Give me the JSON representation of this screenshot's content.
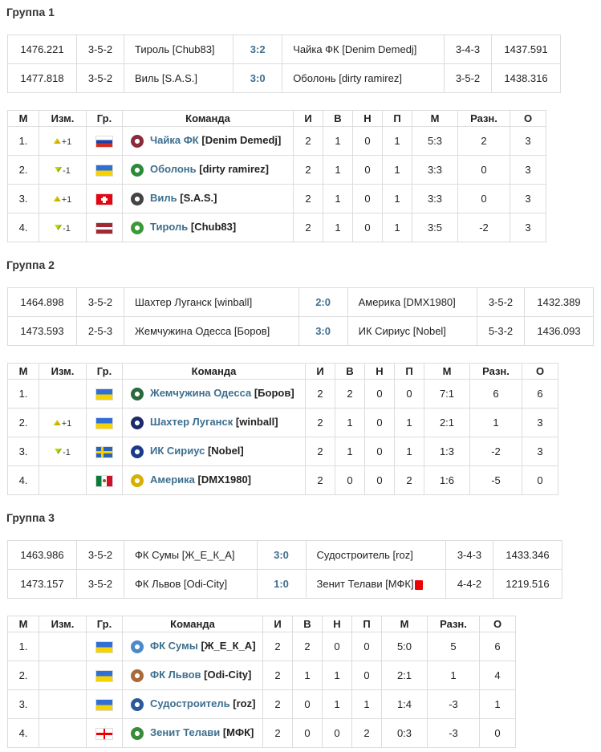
{
  "groups": [
    {
      "title": "Группа 1",
      "matches": [
        {
          "home_rating": "1476.221",
          "home_form": "3-5-2",
          "home": "Тироль [Chub83]",
          "score": "3:2",
          "away": "Чайка ФК [Denim Demedj]",
          "away_form": "3-4-3",
          "away_rating": "1437.591",
          "away_red": false
        },
        {
          "home_rating": "1477.818",
          "home_form": "3-5-2",
          "home": "Виль [S.A.S.]",
          "score": "3:0",
          "away": "Оболонь [dirty ramirez]",
          "away_form": "3-5-2",
          "away_rating": "1438.316",
          "away_red": false
        }
      ],
      "rows": [
        {
          "pos": "1.",
          "chg": "+1",
          "dir": "up",
          "flag": "russia",
          "logo": "seagull-crest-icon",
          "logo_color": "#8a2a3a",
          "team": "Чайка ФК",
          "mgr": "[Denim Demedj]",
          "g": "2",
          "w": "1",
          "d": "0",
          "l": "1",
          "goals": "5:3",
          "diff": "2",
          "pts": "3"
        },
        {
          "pos": "2.",
          "chg": "-1",
          "dir": "down",
          "flag": "ukraine",
          "logo": "obolon-crest-icon",
          "logo_color": "#2a8a3a",
          "team": "Оболонь",
          "mgr": "[dirty ramirez]",
          "g": "2",
          "w": "1",
          "d": "0",
          "l": "1",
          "goals": "3:3",
          "diff": "0",
          "pts": "3"
        },
        {
          "pos": "3.",
          "chg": "+1",
          "dir": "up",
          "flag": "switzerland",
          "logo": "wil-crest-icon",
          "logo_color": "#444444",
          "team": "Виль",
          "mgr": "[S.A.S.]",
          "g": "2",
          "w": "1",
          "d": "0",
          "l": "1",
          "goals": "3:3",
          "diff": "0",
          "pts": "3"
        },
        {
          "pos": "4.",
          "chg": "-1",
          "dir": "down",
          "flag": "latvia",
          "logo": "tyrol-crest-icon",
          "logo_color": "#3a9a3a",
          "team": "Тироль",
          "mgr": "[Chub83]",
          "g": "2",
          "w": "1",
          "d": "0",
          "l": "1",
          "goals": "3:5",
          "diff": "-2",
          "pts": "3"
        }
      ]
    },
    {
      "title": "Группа 2",
      "matches": [
        {
          "home_rating": "1464.898",
          "home_form": "3-5-2",
          "home": "Шахтер Луганск [winball]",
          "score": "2:0",
          "away": "Америка [DMX1980]",
          "away_form": "3-5-2",
          "away_rating": "1432.389",
          "away_red": false
        },
        {
          "home_rating": "1473.593",
          "home_form": "2-5-3",
          "home": "Жемчужина Одесса [Боров]",
          "score": "3:0",
          "away": "ИК Сириус [Nobel]",
          "away_form": "5-3-2",
          "away_rating": "1436.093",
          "away_red": false
        }
      ],
      "rows": [
        {
          "pos": "1.",
          "chg": "",
          "dir": "",
          "flag": "ukraine",
          "logo": "pearl-crest-icon",
          "logo_color": "#2a6a3a",
          "team": "Жемчужина Одесса",
          "mgr": "[Боров]",
          "g": "2",
          "w": "2",
          "d": "0",
          "l": "0",
          "goals": "7:1",
          "diff": "6",
          "pts": "6"
        },
        {
          "pos": "2.",
          "chg": "+1",
          "dir": "up",
          "flag": "ukraine",
          "logo": "shakhtar-crest-icon",
          "logo_color": "#1a2a6a",
          "team": "Шахтер Луганск",
          "mgr": "[winball]",
          "g": "2",
          "w": "1",
          "d": "0",
          "l": "1",
          "goals": "2:1",
          "diff": "1",
          "pts": "3"
        },
        {
          "pos": "3.",
          "chg": "-1",
          "dir": "down",
          "flag": "sweden",
          "logo": "sirius-crest-icon",
          "logo_color": "#1a3a8a",
          "team": "ИК Сириус",
          "mgr": "[Nobel]",
          "g": "2",
          "w": "1",
          "d": "0",
          "l": "1",
          "goals": "1:3",
          "diff": "-2",
          "pts": "3"
        },
        {
          "pos": "4.",
          "chg": "",
          "dir": "",
          "flag": "mexico",
          "logo": "america-crest-icon",
          "logo_color": "#d8b000",
          "team": "Америка",
          "mgr": "[DMX1980]",
          "g": "2",
          "w": "0",
          "d": "0",
          "l": "2",
          "goals": "1:6",
          "diff": "-5",
          "pts": "0"
        }
      ]
    },
    {
      "title": "Группа 3",
      "matches": [
        {
          "home_rating": "1463.986",
          "home_form": "3-5-2",
          "home": "ФК Сумы [Ж_Е_К_А]",
          "score": "3:0",
          "away": "Судостроитель [roz]",
          "away_form": "3-4-3",
          "away_rating": "1433.346",
          "away_red": false
        },
        {
          "home_rating": "1473.157",
          "home_form": "3-5-2",
          "home": "ФК Львов [Odi-City]",
          "score": "1:0",
          "away": "Зенит Телави [МФК]",
          "away_form": "4-4-2",
          "away_rating": "1219.516",
          "away_red": true
        }
      ],
      "rows": [
        {
          "pos": "1.",
          "chg": "",
          "dir": "",
          "flag": "ukraine",
          "logo": "sumy-crest-icon",
          "logo_color": "#4a8ac8",
          "team": "ФК Сумы",
          "mgr": "[Ж_Е_К_А]",
          "g": "2",
          "w": "2",
          "d": "0",
          "l": "0",
          "goals": "5:0",
          "diff": "5",
          "pts": "6"
        },
        {
          "pos": "2.",
          "chg": "",
          "dir": "",
          "flag": "ukraine",
          "logo": "lviv-crest-icon",
          "logo_color": "#a86a3a",
          "team": "ФК Львов",
          "mgr": "[Odi-City]",
          "g": "2",
          "w": "1",
          "d": "1",
          "l": "0",
          "goals": "2:1",
          "diff": "1",
          "pts": "4"
        },
        {
          "pos": "3.",
          "chg": "",
          "dir": "",
          "flag": "ukraine",
          "logo": "sudostroitel-crest-icon",
          "logo_color": "#2a5a9a",
          "team": "Судостроитель",
          "mgr": "[roz]",
          "g": "2",
          "w": "0",
          "d": "1",
          "l": "1",
          "goals": "1:4",
          "diff": "-3",
          "pts": "1"
        },
        {
          "pos": "4.",
          "chg": "",
          "dir": "",
          "flag": "georgia",
          "logo": "zenit-telavi-crest-icon",
          "logo_color": "#3a8a3a",
          "team": "Зенит Телави",
          "mgr": "[МФК]",
          "g": "2",
          "w": "0",
          "d": "0",
          "l": "2",
          "goals": "0:3",
          "diff": "-3",
          "pts": "0"
        }
      ]
    }
  ],
  "headers": {
    "pos": "М",
    "chg": "Изм.",
    "flag": "Гр.",
    "team": "Команда",
    "g": "И",
    "w": "В",
    "d": "Н",
    "l": "П",
    "goals": "М",
    "diff": "Разн.",
    "pts": "О"
  }
}
